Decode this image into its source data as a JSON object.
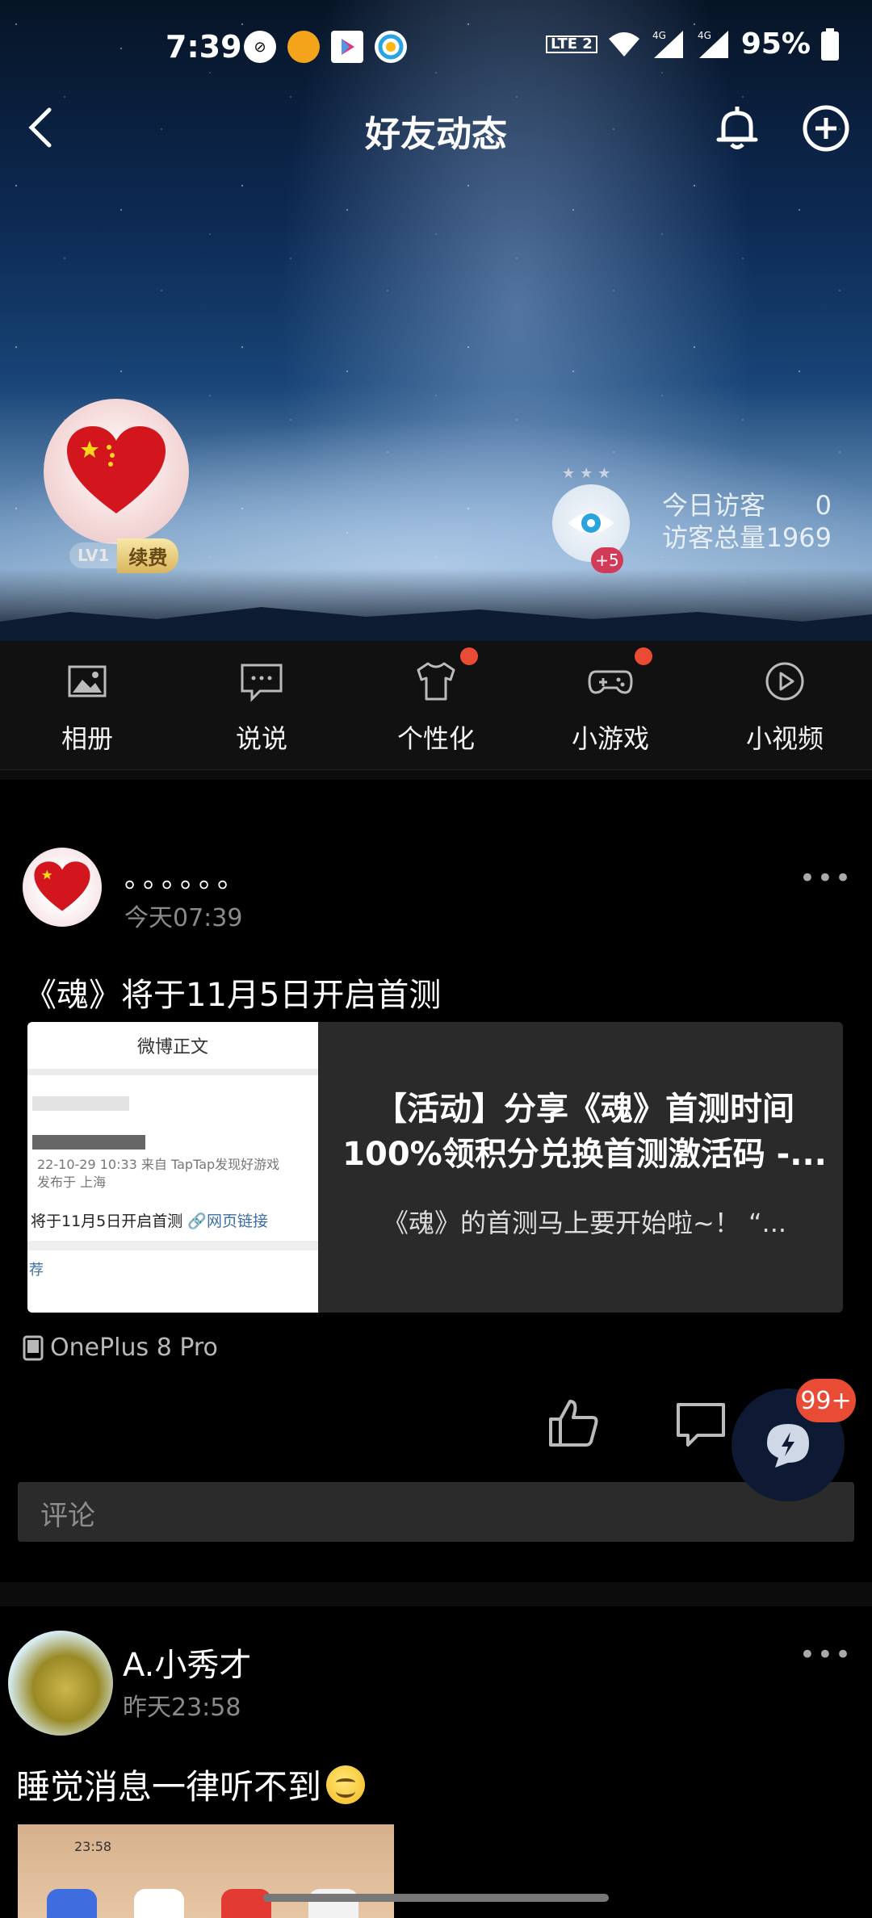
{
  "status_bar": {
    "time": "7:39",
    "battery": "95%",
    "network": "4G",
    "volte": "LTE 2"
  },
  "header": {
    "title": "好友动态"
  },
  "profile": {
    "level": "LV1",
    "renew": "续费",
    "visitor_badge": "+5",
    "today_visitors_label": "今日访客",
    "today_visitors_value": "0",
    "total_visitors_label": "访客总量",
    "total_visitors_value": "1969"
  },
  "features": [
    {
      "label": "相册",
      "icon": "photo-icon",
      "dot": false
    },
    {
      "label": "说说",
      "icon": "chat-icon",
      "dot": false
    },
    {
      "label": "个性化",
      "icon": "shirt-icon",
      "dot": true
    },
    {
      "label": "小游戏",
      "icon": "gamepad-icon",
      "dot": true
    },
    {
      "label": "小视频",
      "icon": "play-icon",
      "dot": false
    }
  ],
  "post1": {
    "name": "。。。。。。",
    "time": "今天07:39",
    "text": "《魂》将于11月5日开启首测",
    "thumb": {
      "header": "微博正文",
      "meta_line1": "22-10-29 10:33  来自 TapTap发现好游戏",
      "meta_line2": "发布于 上海",
      "link_line": "将于11月5日开启首测",
      "link_text": "网页链接",
      "tail": "荐"
    },
    "card_title": "【活动】分享《魂》首测时间100%领积分兑换首测激活码 -...",
    "card_desc": "《魂》的首测马上要开始啦~！ “...",
    "device": "OnePlus 8 Pro",
    "comment_placeholder": "评论"
  },
  "float_badge": "99+",
  "post2": {
    "name": "A.小秀才",
    "time": "昨天23:58",
    "text": "睡觉消息一律听不到",
    "image_time": "23:58"
  }
}
